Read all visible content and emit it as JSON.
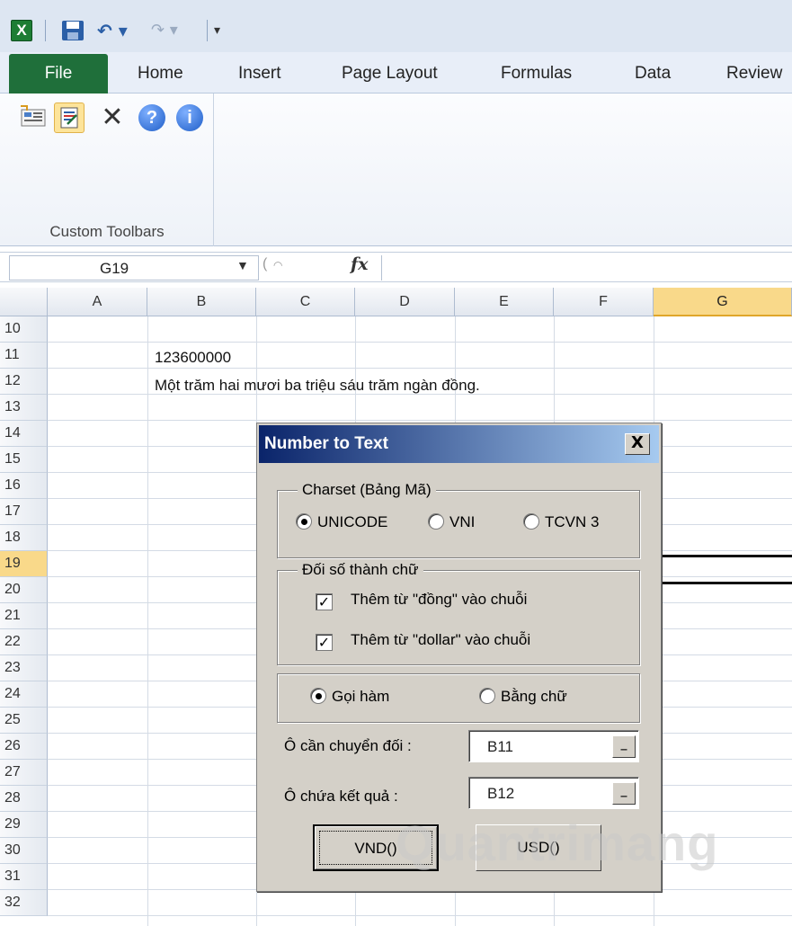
{
  "qat": {
    "excel_icon_label": "X",
    "undo_glyph": "↶ ▾",
    "redo_glyph": "↷ ▾",
    "customize_glyph": "▾"
  },
  "ribbon_tabs": [
    "File",
    "Home",
    "Insert",
    "Page Layout",
    "Formulas",
    "Data",
    "Review"
  ],
  "ribbon": {
    "group_label": "Custom Toolbars",
    "help_glyph": "?",
    "info_glyph": "i",
    "close_glyph": "✕"
  },
  "formula_bar": {
    "name_box": "G19",
    "fx_label": "fx",
    "formula": ""
  },
  "columns": [
    "A",
    "B",
    "C",
    "D",
    "E",
    "F",
    "G"
  ],
  "selected_column": "G",
  "rows": [
    "10",
    "11",
    "12",
    "13",
    "14",
    "15",
    "16",
    "17",
    "18",
    "19",
    "20",
    "21",
    "22",
    "23",
    "24",
    "25",
    "26",
    "27",
    "28",
    "29",
    "30",
    "31",
    "32"
  ],
  "selected_row": "19",
  "cells": {
    "B11": "123600000",
    "B12": "Một trăm hai mươi ba triệu sáu trăm ngàn đồng."
  },
  "dialog": {
    "title": "Number to Text",
    "close_glyph": "X",
    "charset": {
      "legend": "Charset (Bảng Mã)",
      "options": [
        {
          "label": "UNICODE",
          "selected": true
        },
        {
          "label": "VNI",
          "selected": false
        },
        {
          "label": "TCVN 3",
          "selected": false
        }
      ]
    },
    "convert": {
      "legend": "Đối số thành chữ",
      "checks": [
        {
          "label": "Thêm từ \"đồng\" vào chuỗi",
          "checked": true
        },
        {
          "label": "Thêm từ \"dollar\" vào chuỗi",
          "checked": true
        }
      ]
    },
    "mode": {
      "options": [
        {
          "label": "Gọi hàm",
          "selected": true
        },
        {
          "label": "Bằng chữ",
          "selected": false
        }
      ]
    },
    "source_label": "Ô cần chuyển đối :",
    "source_value": "B11",
    "result_label": "Ô chứa kết quả :",
    "result_value": "B12",
    "ref_button_glyph": "_",
    "buttons": {
      "vnd": "VND()",
      "usd": "USD()"
    }
  },
  "watermark": "Quantrimang"
}
